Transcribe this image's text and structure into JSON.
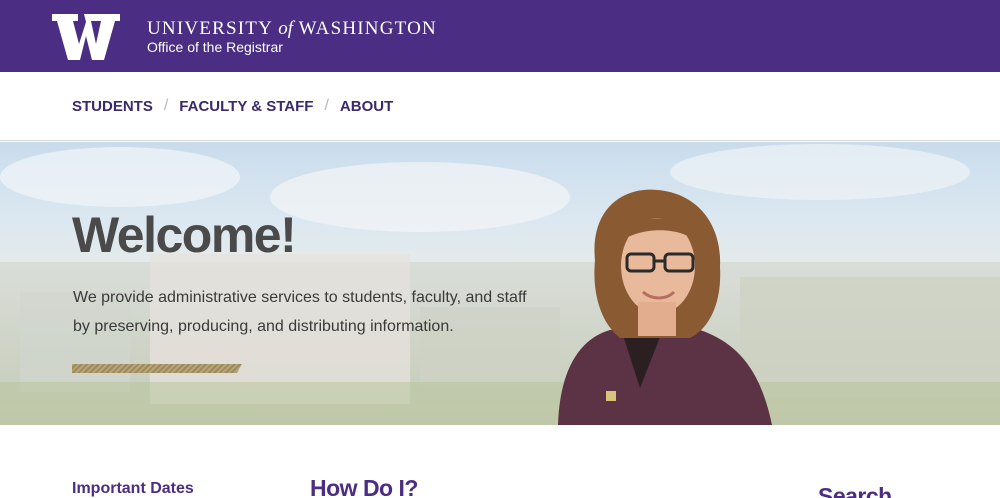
{
  "header": {
    "university_line_1": "UNIVERSITY",
    "university_of": "of",
    "university_line_2": "WASHINGTON",
    "office": "Office of the Registrar",
    "bg_color": "#4b2e83"
  },
  "nav": {
    "items": [
      {
        "label": "STUDENTS"
      },
      {
        "label": "FACULTY & STAFF"
      },
      {
        "label": "ABOUT"
      }
    ],
    "separator": "/"
  },
  "hero": {
    "title": "Welcome!",
    "line_1": "We provide administrative services to students, faculty, and staff",
    "line_2": "by preserving, producing, and distributing information."
  },
  "columns": {
    "important_dates": "Important Dates",
    "how_do_i": "How Do I?",
    "search": "Search"
  },
  "colors": {
    "purple": "#4b2e83",
    "gold": "#b7a57a"
  }
}
